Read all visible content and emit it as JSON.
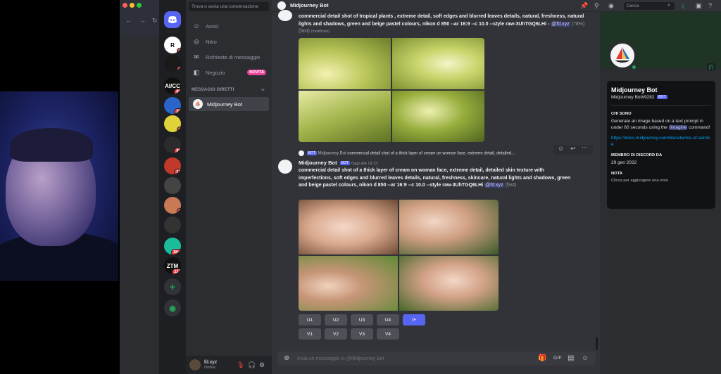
{
  "channel_sidebar": {
    "search_placeholder": "Trova o avvia una conversazione",
    "nav": [
      {
        "label": "Amici",
        "icon": "friends-icon"
      },
      {
        "label": "Nitro",
        "icon": "nitro-icon"
      },
      {
        "label": "Richieste di messaggio",
        "icon": "mail-icon"
      },
      {
        "label": "Negozio",
        "icon": "shop-icon",
        "badge": "NOVITÀ"
      }
    ],
    "dm_header": "MESSAGGI DIRETTI",
    "dm_plus": "+",
    "dm_items": [
      {
        "label": "Midjourney Bot"
      }
    ]
  },
  "servers": [
    {
      "abbr": "R",
      "badge": "1"
    },
    {
      "abbr": "",
      "badge": "2"
    },
    {
      "abbr": "AI/CC",
      "badge": "66"
    },
    {
      "abbr": "",
      "badge": "28"
    },
    {
      "abbr": "",
      "badge": "1"
    },
    {
      "abbr": "",
      "badge": "93"
    },
    {
      "abbr": "",
      "badge": "15"
    },
    {
      "abbr": "",
      "badge": ""
    },
    {
      "abbr": "",
      "badge": "1"
    },
    {
      "abbr": "",
      "badge": ""
    },
    {
      "abbr": "",
      "badge": "1K+"
    },
    {
      "abbr": "ZTM",
      "badge": "117"
    }
  ],
  "user": {
    "name": "fd.xyz",
    "status": "Online"
  },
  "topbar": {
    "title": "Midjourney Bot",
    "search_placeholder": "Cerca"
  },
  "messages": {
    "first_text": "commercial detail shot of tropical plants , extreme detail, soft edges and blurred leaves details, natural, freshness, natural lights and shadows, green and beige pastel colours, nikon d 850 --ar 16:9 --c 10.0 --style raw-3UhTGQ6LHi -",
    "first_mention": "@fd.xyz",
    "first_status": "(78%) (fast)",
    "first_edited": "(modificato)",
    "reply_badge": "BOT",
    "reply_author": "Midjourney Bot",
    "reply_snippet": "commercial detail shot of a thick layer of cream on woman face, extreme detail, detailed...",
    "second_author": "Midjourney Bot",
    "second_badge": "BOT",
    "second_time": "Oggi alle 19:13",
    "second_text": "commercial detail shot of a thick layer of cream on woman face, extreme detail, detailed skin texture with imperfections, soft edges and blurred leaves details, natural, freshness, skincare, natural lights and shadows, green and beige pastel colours, nikon d 850 --ar 16:9 --c 10.0 --style raw-3UhTGQ6LHi",
    "second_mention": "@fd.xyz",
    "second_speed": "(fast)"
  },
  "buttons_row1": [
    "U1",
    "U2",
    "U3",
    "U4"
  ],
  "buttons_row2": [
    "V1",
    "V2",
    "V3",
    "V4"
  ],
  "composer": {
    "placeholder": "Invia un messaggio in @Midjourney Bot"
  },
  "profile": {
    "name": "Midjourney Bot",
    "tag": "Midjourney Bot#9282",
    "badge": "BOT",
    "about_header": "CHI SONO",
    "about_pre": "Generate an image based on a text prompt in under 60 seconds using the",
    "about_cmd": "/imagine",
    "about_post": "command!",
    "link": "https://docs.midjourney.com/docs/terms-of-service",
    "member_header": "MEMBRO DI DISCORD DA",
    "member_date": "29 gen 2022",
    "note_header": "NOTA",
    "note_placeholder": "Clicca per aggiungere una nota"
  },
  "colors": {
    "accent": "#5865f2",
    "online": "#23a559",
    "mention_bg": "#3c4270",
    "badge_red": "#f23f43"
  }
}
